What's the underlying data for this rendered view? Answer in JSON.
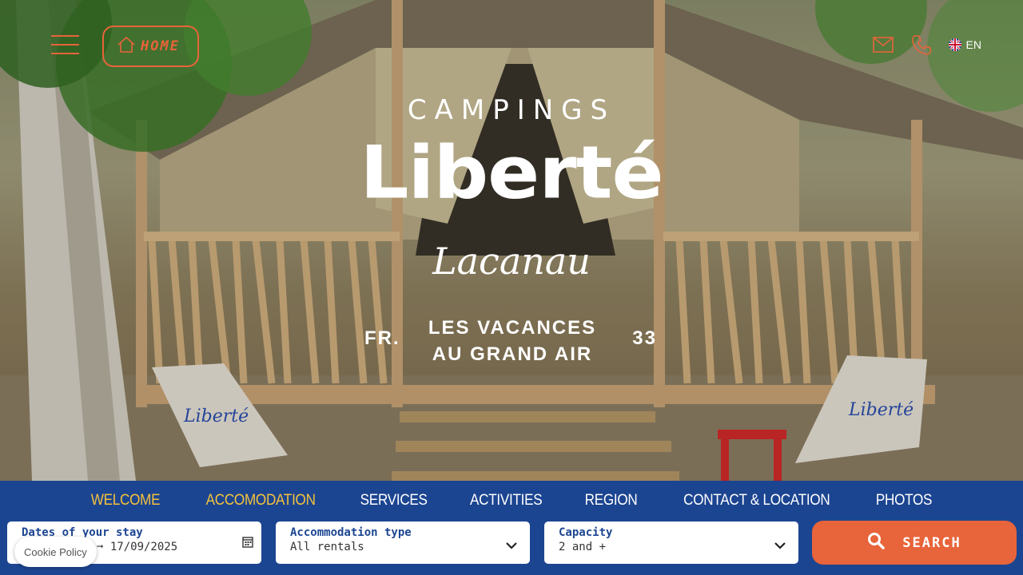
{
  "header": {
    "home_label": "HOME",
    "lang_label": "EN"
  },
  "hero": {
    "brand_top": "CAMPINGS",
    "brand_name": "Liberté",
    "place": "Lacanau",
    "tagline_left": "FR.",
    "tagline_line1": "LES VACANCES",
    "tagline_line2": "AU GRAND AIR",
    "tagline_right": "33",
    "chair_text": "Liberté"
  },
  "nav": {
    "items": [
      {
        "label": "WELCOME",
        "active": true
      },
      {
        "label": "ACCOMODATION",
        "active": true
      },
      {
        "label": "SERVICES",
        "active": false
      },
      {
        "label": "ACTIVITIES",
        "active": false
      },
      {
        "label": "REGION",
        "active": false
      },
      {
        "label": "CONTACT & LOCATION",
        "active": false
      },
      {
        "label": "PHOTOS",
        "active": false
      }
    ]
  },
  "booking": {
    "dates_label": "Dates of your stay",
    "dates_value": "17/09/2025",
    "type_label": "Accommodation type",
    "type_value": "All rentals",
    "capacity_label": "Capacity",
    "capacity_value": "2 and +",
    "search_label": "SEARCH"
  },
  "cookie": {
    "label": "Cookie Policy"
  },
  "colors": {
    "accent": "#e8643a",
    "navy": "#1c4591",
    "highlight": "#f5c23c"
  }
}
